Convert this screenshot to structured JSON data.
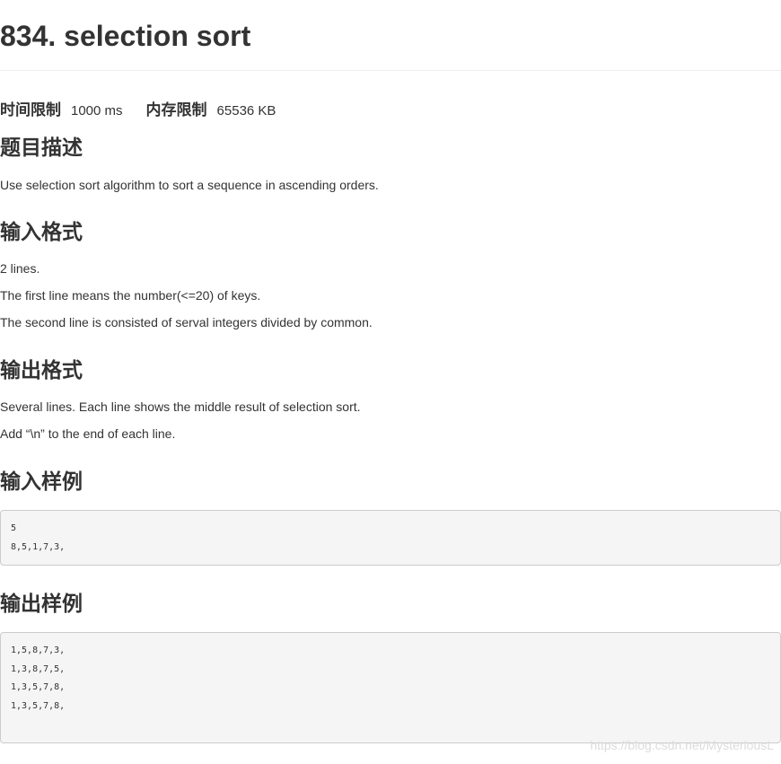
{
  "problem": {
    "title": "834. selection sort"
  },
  "limits": {
    "time_label": "时间限制",
    "time_value": "1000 ms",
    "memory_label": "内存限制",
    "memory_value": "65536 KB"
  },
  "description": {
    "heading": "题目描述",
    "text": "Use selection sort algorithm to sort a sequence in ascending orders."
  },
  "input_format": {
    "heading": "输入格式",
    "lines": [
      "2 lines.",
      "The first line means the number(<=20) of keys.",
      "The second line is consisted of serval integers divided by common."
    ]
  },
  "output_format": {
    "heading": "输出格式",
    "lines": [
      "Several lines. Each line shows the middle result of selection sort.",
      "Add “\\n” to the end of each line."
    ]
  },
  "sample_input": {
    "heading": "输入样例",
    "lines": [
      "5",
      "8,5,1,7,3,"
    ]
  },
  "sample_output": {
    "heading": "输出样例",
    "lines": [
      "1,5,8,7,3,",
      "1,3,8,7,5,",
      "1,3,5,7,8,",
      "1,3,5,7,8,"
    ]
  },
  "watermark": {
    "text": "https://blog.csdn.net/MysteriousL"
  }
}
